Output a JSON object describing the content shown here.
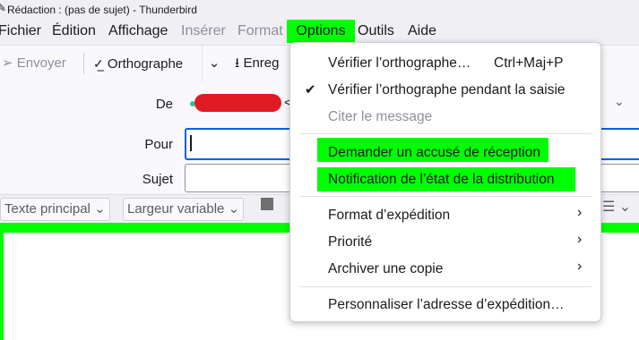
{
  "window": {
    "title": "Rédaction : (pas de sujet) - Thunderbird"
  },
  "menubar": {
    "items": [
      {
        "label": "Fichier",
        "enabled": true
      },
      {
        "label": "Édition",
        "enabled": true
      },
      {
        "label": "Affichage",
        "enabled": true
      },
      {
        "label": "Insérer",
        "enabled": false
      },
      {
        "label": "Format",
        "enabled": false
      },
      {
        "label": "Options",
        "enabled": true,
        "active": true
      },
      {
        "label": "Outils",
        "enabled": true
      },
      {
        "label": "Aide",
        "enabled": true
      }
    ]
  },
  "toolbar": {
    "send_label": "Envoyer",
    "spelling_label": "Orthographe",
    "save_label": "Enreg"
  },
  "headers": {
    "from_label": "De",
    "to_label": "Pour",
    "subject_label": "Sujet"
  },
  "formatbar": {
    "paragraph_label": "Texte principal",
    "font_label": "Largeur variable"
  },
  "options_menu": {
    "check_spelling": {
      "label": "Vérifier l’orthographe…",
      "shortcut": "Ctrl+Maj+P"
    },
    "spell_as_you_type": {
      "label": "Vérifier l’orthographe pendant la saisie",
      "checked": true
    },
    "quote_message": {
      "label": "Citer le message",
      "enabled": false
    },
    "return_receipt": {
      "label": "Demander un accusé de réception"
    },
    "dsn": {
      "label": "Notification de l’état de la distribution"
    },
    "delivery_format": {
      "label": "Format d’expédition"
    },
    "priority": {
      "label": "Priorité"
    },
    "archive_copy": {
      "label": "Archiver une copie"
    },
    "customize_from": {
      "label": "Personnaliser l’adresse d’expédition…"
    }
  },
  "colors": {
    "highlight": "#00ff00",
    "redacted": "#e01b24",
    "focus": "#0061e0"
  }
}
